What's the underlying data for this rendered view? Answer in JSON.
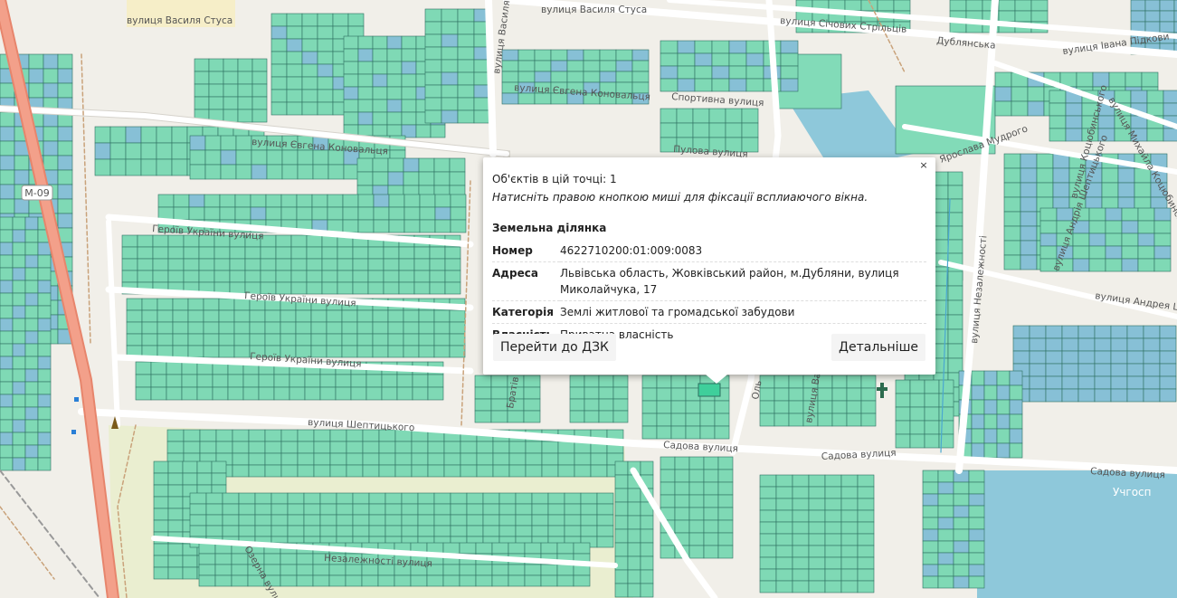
{
  "popup": {
    "close_glyph": "×",
    "count_text": "Об'єктів в цій точці: 1",
    "hint_text": "Натисніть правою кнопкою миші для фіксації всплиаючого вікна.",
    "section_title": "Земельна ділянка",
    "fields": [
      {
        "label": "Номер",
        "value": "4622710200:01:009:0083"
      },
      {
        "label": "Адреса",
        "value": "Львівська область, Жовківський район, м.Дубляни, вулиця Миколайчука, 17"
      },
      {
        "label": "Категорія",
        "value": "Землі житлової та громадської забудови"
      },
      {
        "label": "Власність",
        "value": "Приватна власність"
      }
    ],
    "btn_dzk": "Перейти до ДЗК",
    "btn_details": "Детальніше"
  },
  "map": {
    "road_shield": "М-09",
    "streets": {
      "stusa_1": "вулиця Василя Стуса",
      "stusa_2": "вулиця Василя Стуса",
      "stusa_3": "вулиця Василя Стуса",
      "konovaltsia_1": "вулиця Євгена Коновальця",
      "konovaltsia_2": "вулиця Євгена Коновальця",
      "sich_strilciv": "вулиця Січових Стрільців",
      "sportyvna": "Спортивна вулиця",
      "pulova": "Пулова вулиця",
      "heroiv_1": "Героїв України вулиця",
      "heroiv_2": "Героїв України вулиця",
      "heroiv_3": "Героїв України вулиця",
      "sheptytskoho": "вулиця Шептицького",
      "sadova_1": "Садова вулиця",
      "sadova_2": "Садова вулиця",
      "sadova_3": "Садова вулиця",
      "nezalezhnosti_h": "Незалежності вулиця",
      "nezalezhnosti_v": "вулиця Незалежності",
      "ozerna": "Озерна вулиця",
      "yaroslava": "Ярослава Мудрого",
      "andriya_sheptytskoho_1": "вулиця Андрія Шептицького",
      "andriya_sheptytskoho_2": "вулиця Андрея Шептицького",
      "ivana_pidkovy": "вулиця Івана Підкови",
      "kotsiubynskoho": "вулиця Коцюбинського",
      "mykhailo_kotsiubynskoho": "вулиця Михайла Коцюбинського",
      "dublianska": "Дублянська",
      "vasylia": "вулиця Ва",
      "bratska": "Братів",
      "olia": "Оль"
    },
    "place_uchhosp": "Учгосп",
    "colors": {
      "background": "#f1efe9",
      "parcel_green": "#7fd9b5",
      "parcel_blue": "#87c0d6",
      "parcel_stroke": "#2d6f60",
      "highway": "#f3a08a",
      "road": "#ffffff"
    }
  }
}
